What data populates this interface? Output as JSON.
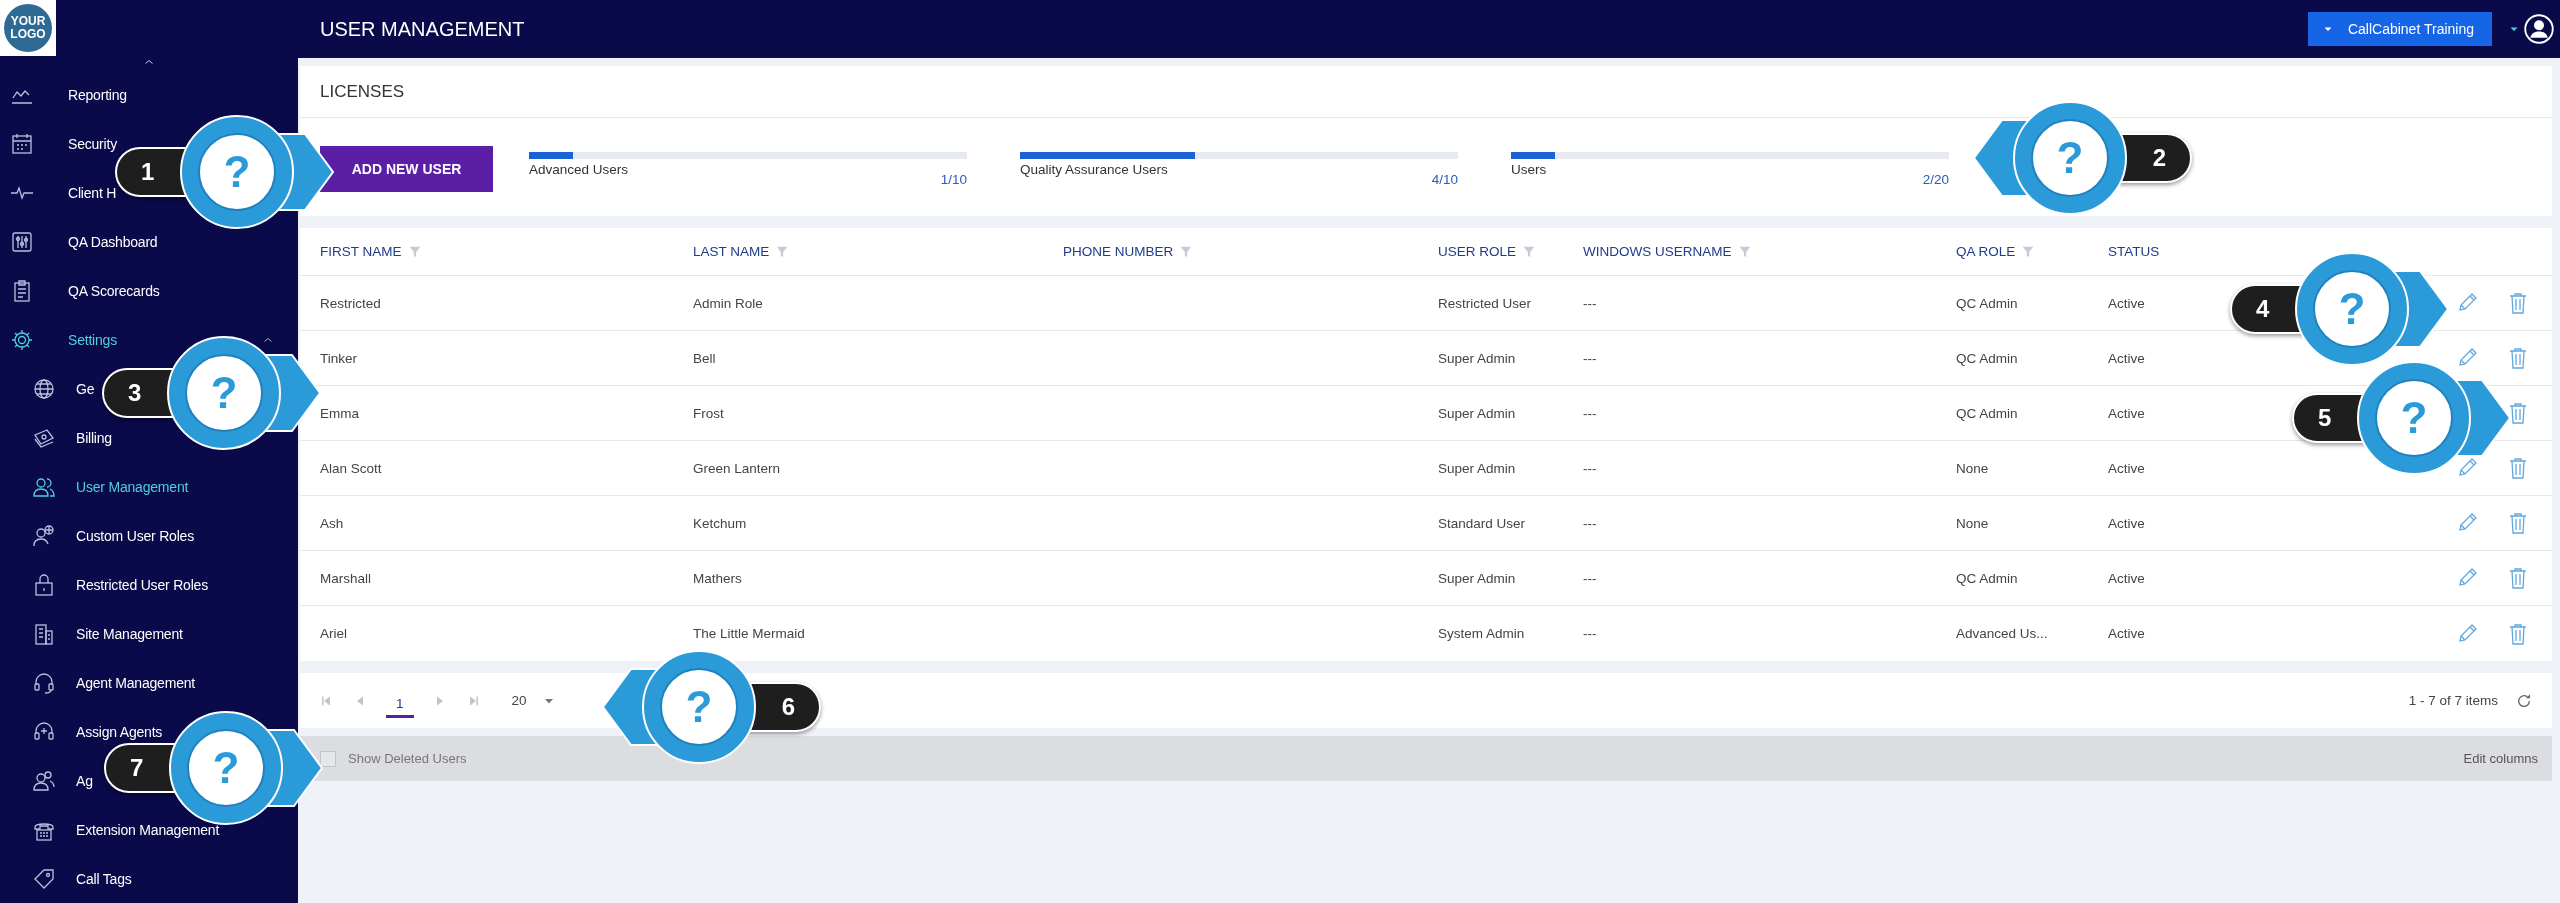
{
  "header": {
    "title": "USER MANAGEMENT",
    "account_button": "CallCabinet Training"
  },
  "sidebar": {
    "logo": "YOUR LOGO",
    "items": [
      {
        "label": "Reporting",
        "selected": false
      },
      {
        "label": "Security",
        "selected": false
      },
      {
        "label": "Client H",
        "selected": false
      },
      {
        "label": "QA Dashboard",
        "selected": false
      },
      {
        "label": "QA Scorecards",
        "selected": false
      },
      {
        "label": "Settings",
        "selected": true,
        "expanded": true,
        "children": [
          {
            "label": "Ge",
            "selected": false
          },
          {
            "label": "Billing",
            "selected": false
          },
          {
            "label": "User Management",
            "selected": true
          },
          {
            "label": "Custom User Roles",
            "selected": false
          },
          {
            "label": "Restricted User Roles",
            "selected": false
          },
          {
            "label": "Site Management",
            "selected": false
          },
          {
            "label": "Agent Management",
            "selected": false
          },
          {
            "label": "Assign Agents",
            "selected": false
          },
          {
            "label": "Ag",
            "selected": false
          },
          {
            "label": "Extension Management",
            "selected": false
          },
          {
            "label": "Call Tags",
            "selected": false
          }
        ]
      }
    ]
  },
  "licenses": {
    "title": "LICENSES",
    "add_button": "ADD NEW USER",
    "meters": [
      {
        "label": "Advanced Users",
        "count": "1/10",
        "level": 0.1
      },
      {
        "label": "Quality Assurance Users",
        "count": "4/10",
        "level": 0.4
      },
      {
        "label": "Users",
        "count": "2/20",
        "level": 0.1
      }
    ]
  },
  "table": {
    "columns": [
      {
        "label": "FIRST NAME",
        "filterable": true
      },
      {
        "label": "LAST NAME",
        "filterable": true
      },
      {
        "label": "PHONE NUMBER",
        "filterable": true
      },
      {
        "label": "USER ROLE",
        "filterable": true
      },
      {
        "label": "WINDOWS USERNAME",
        "filterable": true
      },
      {
        "label": "QA ROLE",
        "filterable": true
      },
      {
        "label": "STATUS",
        "filterable": false
      }
    ],
    "rows": [
      {
        "first_name": "Restricted",
        "last_name": "Admin Role",
        "user_role": "Restricted User",
        "windows_username": "---",
        "qa_role": "QC Admin",
        "status": "Active"
      },
      {
        "first_name": "Tinker",
        "last_name": "Bell",
        "user_role": "Super Admin",
        "windows_username": "---",
        "qa_role": "QC Admin",
        "status": "Active"
      },
      {
        "first_name": "Emma",
        "last_name": "Frost",
        "user_role": "Super Admin",
        "windows_username": "---",
        "qa_role": "QC Admin",
        "status": "Active"
      },
      {
        "first_name": "Alan Scott",
        "last_name": "Green Lantern",
        "user_role": "Super Admin",
        "windows_username": "---",
        "qa_role": "None",
        "status": "Active"
      },
      {
        "first_name": "Ash",
        "last_name": "Ketchum",
        "user_role": "Standard User",
        "windows_username": "---",
        "qa_role": "None",
        "status": "Active"
      },
      {
        "first_name": "Marshall",
        "last_name": "Mathers",
        "user_role": "Super Admin",
        "windows_username": "---",
        "qa_role": "QC Admin",
        "status": "Active"
      },
      {
        "first_name": "Ariel",
        "last_name": "The Little Mermaid",
        "user_role": "System Admin",
        "windows_username": "---",
        "qa_role": "Advanced Us...",
        "status": "Active"
      }
    ]
  },
  "pager": {
    "page": "1",
    "page_size": "20",
    "summary": "1 - 7 of 7 items"
  },
  "footer": {
    "show_deleted": {
      "label": "Show Deleted Users",
      "checked": false
    },
    "edit_columns": "Edit columns"
  },
  "callouts": [
    {
      "number": "1",
      "symbol": "?"
    },
    {
      "number": "2",
      "symbol": "?"
    },
    {
      "number": "3",
      "symbol": "?"
    },
    {
      "number": "4",
      "symbol": "?"
    },
    {
      "number": "5",
      "symbol": "?"
    },
    {
      "number": "6",
      "symbol": "?"
    },
    {
      "number": "7",
      "symbol": "?"
    }
  ]
}
